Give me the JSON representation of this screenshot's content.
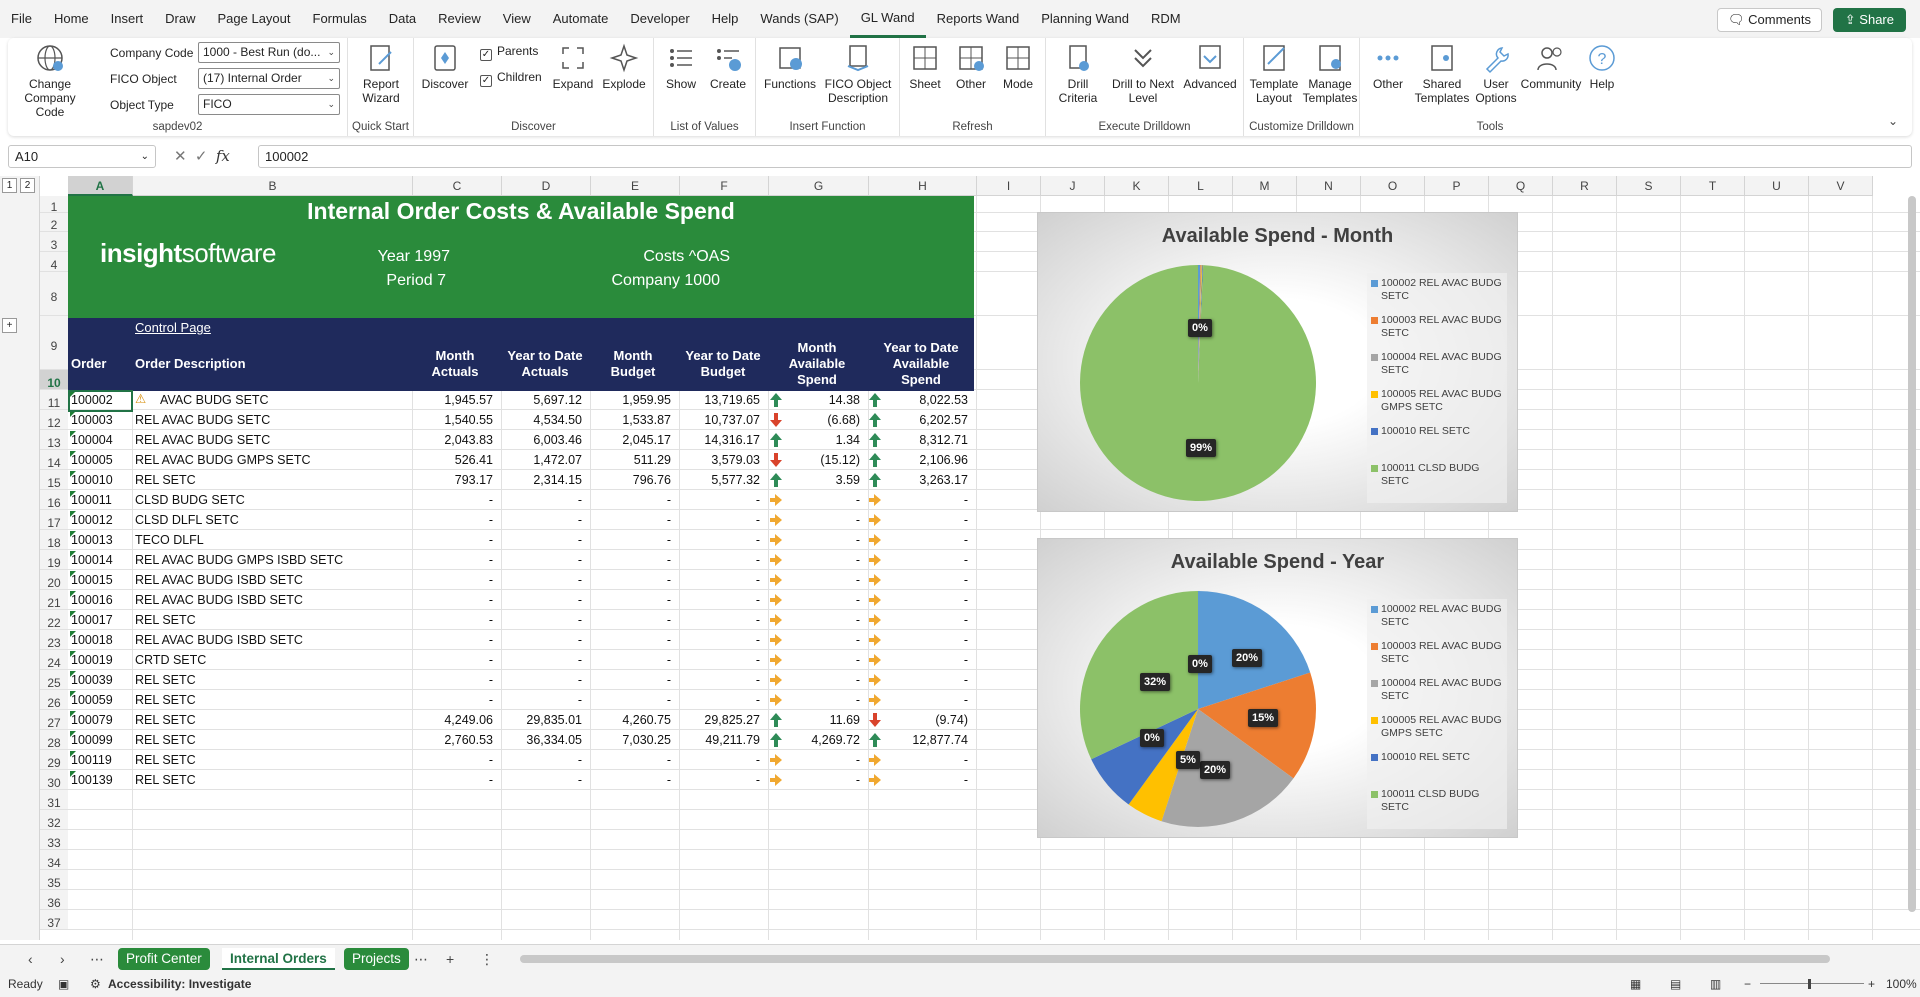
{
  "menu": [
    "File",
    "Home",
    "Insert",
    "Draw",
    "Page Layout",
    "Formulas",
    "Data",
    "Review",
    "View",
    "Automate",
    "Developer",
    "Help",
    "Wands (SAP)",
    "GL Wand",
    "Reports Wand",
    "Planning Wand",
    "RDM"
  ],
  "menu_active": "GL Wand",
  "comments_label": "Comments",
  "share_label": "Share",
  "ribbon": {
    "change_company_code": "Change Company Code",
    "company_code_label": "Company Code",
    "company_code_value": "1000 - Best Run (do...",
    "fico_object_label": "FICO Object",
    "fico_object_value": "(17) Internal Order",
    "object_type_label": "Object Type",
    "object_type_value": "FICO",
    "group_sapdev": "sapdev02",
    "report_wizard": "Report Wizard",
    "group_quickstart": "Quick Start",
    "discover": "Discover",
    "parents": "Parents",
    "children": "Children",
    "expand": "Expand",
    "explode": "Explode",
    "group_discover": "Discover",
    "show": "Show",
    "create": "Create",
    "group_lov": "List of Values",
    "functions": "Functions",
    "fico_desc": "FICO Object Description",
    "group_insert": "Insert Function",
    "sheet": "Sheet",
    "other": "Other",
    "mode": "Mode",
    "group_refresh": "Refresh",
    "drill_criteria": "Drill Criteria",
    "drill_next": "Drill to Next Level",
    "advanced": "Advanced",
    "group_drill": "Execute Drilldown",
    "template_layout": "Template Layout",
    "manage_templates": "Manage Templates",
    "group_customize": "Customize Drilldown",
    "other2": "Other",
    "shared_templates": "Shared Templates",
    "user_options": "User Options",
    "community": "Community",
    "help": "Help",
    "group_tools": "Tools"
  },
  "namebox": "A10",
  "formula": "100002",
  "columns": [
    "A",
    "B",
    "C",
    "D",
    "E",
    "F",
    "G",
    "H",
    "I",
    "J",
    "K",
    "L",
    "M",
    "N",
    "O",
    "P",
    "Q",
    "R",
    "S",
    "T",
    "U",
    "V"
  ],
  "row_numbers": [
    "1",
    "2",
    "3",
    "4",
    "8",
    "9",
    "10",
    "11",
    "12",
    "13",
    "14",
    "15",
    "16",
    "17",
    "18",
    "19",
    "20",
    "21",
    "22",
    "23",
    "24",
    "25",
    "26",
    "27",
    "28",
    "29",
    "30",
    "31",
    "32",
    "33",
    "34",
    "35",
    "36",
    "37"
  ],
  "report": {
    "title": "Internal Order Costs & Available Spend",
    "logo_a": "insight",
    "logo_b": "software",
    "year": "Year 1997",
    "period": "Period 7",
    "costs": "Costs ^OAS",
    "company": "Company 1000",
    "control_link": "Control Page",
    "headers": [
      "Order",
      "Order Description",
      "Month Actuals",
      "Year to Date Actuals",
      "Month Budget",
      "Year to Date Budget",
      "Month Available Spend",
      "Year to Date Available Spend"
    ]
  },
  "rows": [
    {
      "order": "100002",
      "desc": "AVAC BUDG SETC",
      "warn": true,
      "c": "1,945.57",
      "d": "5,697.12",
      "e": "1,959.95",
      "f": "13,719.65",
      "g": "14.38",
      "ga": "up",
      "h": "8,022.53",
      "ha": "up"
    },
    {
      "order": "100003",
      "desc": "REL  AVAC BUDG SETC",
      "c": "1,540.55",
      "d": "4,534.50",
      "e": "1,533.87",
      "f": "10,737.07",
      "g": "(6.68)",
      "ga": "down",
      "h": "6,202.57",
      "ha": "up"
    },
    {
      "order": "100004",
      "desc": "REL  AVAC BUDG SETC",
      "c": "2,043.83",
      "d": "6,003.46",
      "e": "2,045.17",
      "f": "14,316.17",
      "g": "1.34",
      "ga": "up",
      "h": "8,312.71",
      "ha": "up"
    },
    {
      "order": "100005",
      "desc": "REL  AVAC BUDG GMPS SETC",
      "c": "526.41",
      "d": "1,472.07",
      "e": "511.29",
      "f": "3,579.03",
      "g": "(15.12)",
      "ga": "down",
      "h": "2,106.96",
      "ha": "up"
    },
    {
      "order": "100010",
      "desc": "REL  SETC",
      "c": "793.17",
      "d": "2,314.15",
      "e": "796.76",
      "f": "5,577.32",
      "g": "3.59",
      "ga": "up",
      "h": "3,263.17",
      "ha": "up"
    },
    {
      "order": "100011",
      "desc": "CLSD BUDG SETC",
      "c": "-",
      "d": "-",
      "e": "-",
      "f": "-",
      "g": "-",
      "ga": "right",
      "h": "-",
      "ha": "right"
    },
    {
      "order": "100012",
      "desc": "CLSD DLFL SETC",
      "c": "-",
      "d": "-",
      "e": "-",
      "f": "-",
      "g": "-",
      "ga": "right",
      "h": "-",
      "ha": "right"
    },
    {
      "order": "100013",
      "desc": "TECO DLFL",
      "c": "-",
      "d": "-",
      "e": "-",
      "f": "-",
      "g": "-",
      "ga": "right",
      "h": "-",
      "ha": "right"
    },
    {
      "order": "100014",
      "desc": "REL  AVAC BUDG GMPS ISBD SETC",
      "c": "-",
      "d": "-",
      "e": "-",
      "f": "-",
      "g": "-",
      "ga": "right",
      "h": "-",
      "ha": "right"
    },
    {
      "order": "100015",
      "desc": "REL  AVAC BUDG ISBD SETC",
      "c": "-",
      "d": "-",
      "e": "-",
      "f": "-",
      "g": "-",
      "ga": "right",
      "h": "-",
      "ha": "right"
    },
    {
      "order": "100016",
      "desc": "REL  AVAC BUDG ISBD SETC",
      "c": "-",
      "d": "-",
      "e": "-",
      "f": "-",
      "g": "-",
      "ga": "right",
      "h": "-",
      "ha": "right"
    },
    {
      "order": "100017",
      "desc": "REL  SETC",
      "c": "-",
      "d": "-",
      "e": "-",
      "f": "-",
      "g": "-",
      "ga": "right",
      "h": "-",
      "ha": "right"
    },
    {
      "order": "100018",
      "desc": "REL  AVAC BUDG ISBD SETC",
      "c": "-",
      "d": "-",
      "e": "-",
      "f": "-",
      "g": "-",
      "ga": "right",
      "h": "-",
      "ha": "right"
    },
    {
      "order": "100019",
      "desc": "CRTD SETC",
      "c": "-",
      "d": "-",
      "e": "-",
      "f": "-",
      "g": "-",
      "ga": "right",
      "h": "-",
      "ha": "right"
    },
    {
      "order": "100039",
      "desc": "REL  SETC",
      "c": "-",
      "d": "-",
      "e": "-",
      "f": "-",
      "g": "-",
      "ga": "right",
      "h": "-",
      "ha": "right"
    },
    {
      "order": "100059",
      "desc": "REL  SETC",
      "c": "-",
      "d": "-",
      "e": "-",
      "f": "-",
      "g": "-",
      "ga": "right",
      "h": "-",
      "ha": "right"
    },
    {
      "order": "100079",
      "desc": "REL  SETC",
      "c": "4,249.06",
      "d": "29,835.01",
      "e": "4,260.75",
      "f": "29,825.27",
      "g": "11.69",
      "ga": "up",
      "h": "(9.74)",
      "ha": "down"
    },
    {
      "order": "100099",
      "desc": "REL  SETC",
      "c": "2,760.53",
      "d": "36,334.05",
      "e": "7,030.25",
      "f": "49,211.79",
      "g": "4,269.72",
      "ga": "up",
      "h": "12,877.74",
      "ha": "up"
    },
    {
      "order": "100119",
      "desc": "REL  SETC",
      "c": "-",
      "d": "-",
      "e": "-",
      "f": "-",
      "g": "-",
      "ga": "right",
      "h": "-",
      "ha": "right"
    },
    {
      "order": "100139",
      "desc": "REL  SETC",
      "c": "-",
      "d": "-",
      "e": "-",
      "f": "-",
      "g": "-",
      "ga": "right",
      "h": "-",
      "ha": "right"
    }
  ],
  "arrow_colors": {
    "up": "#2e8b57",
    "down": "#d9432b",
    "right": "#f0a830"
  },
  "chart_data": [
    {
      "type": "pie",
      "title": "Available Spend - Month",
      "categories": [
        "100002 REL  AVAC BUDG SETC",
        "100003 REL  AVAC BUDG SETC",
        "100004 REL  AVAC BUDG SETC",
        "100005 REL  AVAC BUDG GMPS SETC",
        "100010 REL  SETC",
        "100011 CLSD BUDG SETC"
      ],
      "values": [
        0.3,
        0.1,
        0.1,
        0.1,
        0.1,
        99.3
      ],
      "data_labels": [
        "0%",
        "99%"
      ],
      "colors": [
        "#5b9bd5",
        "#ed7d31",
        "#a5a5a5",
        "#ffc000",
        "#4472c4",
        "#8cc168"
      ],
      "legend": "right"
    },
    {
      "type": "pie",
      "title": "Available Spend - Year",
      "categories": [
        "100002 REL  AVAC BUDG SETC",
        "100003 REL  AVAC BUDG SETC",
        "100004 REL  AVAC BUDG SETC",
        "100005 REL  AVAC BUDG GMPS SETC",
        "100010 REL  SETC",
        "100011 CLSD BUDG SETC"
      ],
      "values": [
        20,
        15,
        20,
        5,
        8,
        32
      ],
      "data_labels": [
        "20%",
        "15%",
        "20%",
        "5%",
        "0%",
        "32%",
        "0%"
      ],
      "colors": [
        "#5b9bd5",
        "#ed7d31",
        "#a5a5a5",
        "#ffc000",
        "#4472c4",
        "#8cc168"
      ],
      "legend": "right"
    }
  ],
  "sheet_tabs": [
    "Profit Center",
    "Internal Orders",
    "Projects"
  ],
  "sheet_active": "Internal Orders",
  "status": {
    "ready": "Ready",
    "accessibility": "Accessibility: Investigate",
    "zoom": "100%"
  }
}
